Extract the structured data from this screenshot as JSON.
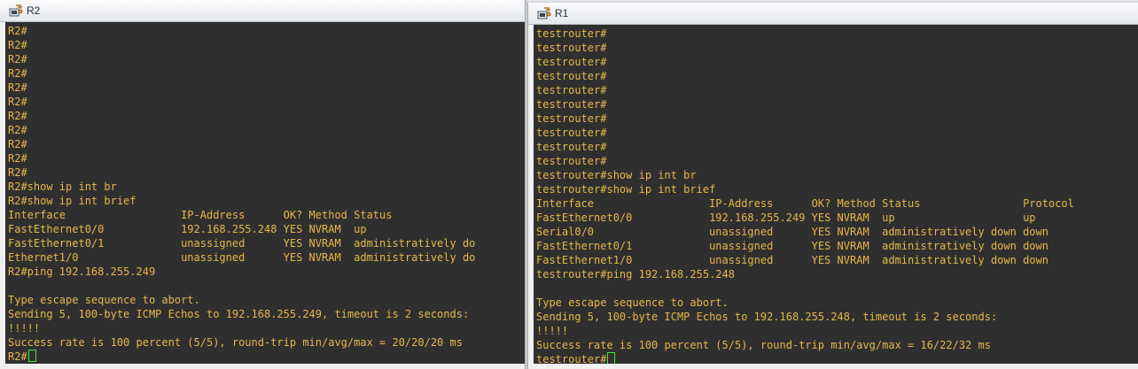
{
  "r2": {
    "title": "R2",
    "lines": [
      "R2#",
      "R2#",
      "R2#",
      "R2#",
      "R2#",
      "R2#",
      "R2#",
      "R2#",
      "R2#",
      "R2#",
      "R2#",
      "R2#show ip int br",
      "R2#show ip int brief",
      "Interface                  IP-Address      OK? Method Status",
      "FastEthernet0/0            192.168.255.248 YES NVRAM  up",
      "FastEthernet0/1            unassigned      YES NVRAM  administratively do",
      "Ethernet1/0                unassigned      YES NVRAM  administratively do",
      "R2#ping 192.168.255.249",
      "",
      "Type escape sequence to abort.",
      "Sending 5, 100-byte ICMP Echos to 192.168.255.249, timeout is 2 seconds:",
      "!!!!!",
      "Success rate is 100 percent (5/5), round-trip min/avg/max = 20/20/20 ms"
    ],
    "prompt": "R2#"
  },
  "r1": {
    "title": "R1",
    "lines": [
      "testrouter#",
      "testrouter#",
      "testrouter#",
      "testrouter#",
      "testrouter#",
      "testrouter#",
      "testrouter#",
      "testrouter#",
      "testrouter#",
      "testrouter#",
      "testrouter#show ip int br",
      "testrouter#show ip int brief",
      "Interface                  IP-Address      OK? Method Status                Protocol",
      "FastEthernet0/0            192.168.255.249 YES NVRAM  up                    up",
      "Serial0/0                  unassigned      YES NVRAM  administratively down down",
      "FastEthernet0/1            unassigned      YES NVRAM  administratively down down",
      "FastEthernet1/0            unassigned      YES NVRAM  administratively down down",
      "testrouter#ping 192.168.255.248",
      "",
      "Type escape sequence to abort.",
      "Sending 5, 100-byte ICMP Echos to 192.168.255.248, timeout is 2 seconds:",
      "!!!!!",
      "Success rate is 100 percent (5/5), round-trip min/avg/max = 16/22/32 ms"
    ],
    "prompt": "testrouter#"
  },
  "colors": {
    "terminal_bg": "#2f2f2f",
    "terminal_text": "#e6b84a",
    "cursor": "#3ee83e"
  },
  "icons": {
    "window_icon": "router-console-icon"
  }
}
